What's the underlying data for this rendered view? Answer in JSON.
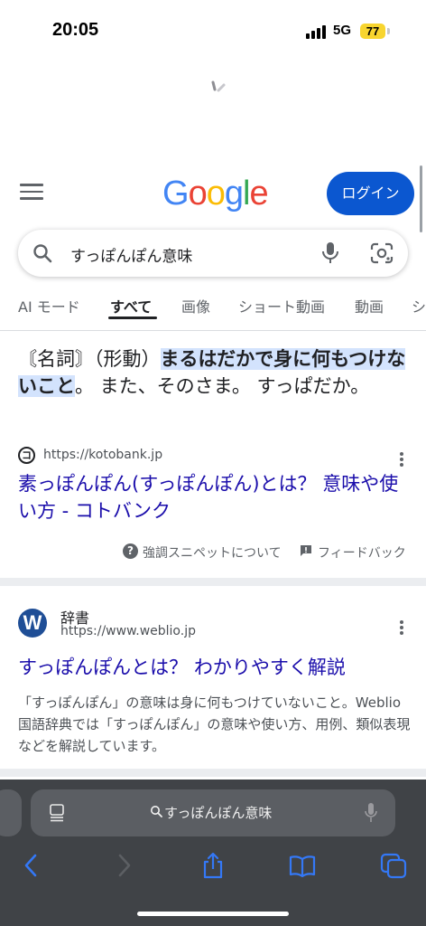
{
  "status_bar": {
    "time": "20:05",
    "network": "5G",
    "battery": "77"
  },
  "header": {
    "logo_letters": [
      {
        "char": "G",
        "color": "#4285F4"
      },
      {
        "char": "o",
        "color": "#EA4335"
      },
      {
        "char": "o",
        "color": "#FBBC05"
      },
      {
        "char": "g",
        "color": "#4285F4"
      },
      {
        "char": "l",
        "color": "#34A853"
      },
      {
        "char": "e",
        "color": "#EA4335"
      }
    ],
    "login_label": "ログイン"
  },
  "search": {
    "query": "すっぽんぽん意味"
  },
  "tabs": [
    "AI モード",
    "すべて",
    "画像",
    "ショート動画",
    "動画",
    "シ"
  ],
  "active_tab": "すべて",
  "featured_snippet": {
    "text_before": "〘名詞〙（形動）",
    "highlight": "まるはだかで身に何もつけないこと",
    "text_after": "。 また、そのさま。 すっぱだか。",
    "site_url": "https://kotobank.jp",
    "favicon_char": "コ",
    "title": "素っぽんぽん(すっぽんぽん)とは？ 意味や使い方 - コトバンク",
    "about_label": "強調スニペットについて",
    "feedback_label": "フィードバック"
  },
  "result2": {
    "favicon_char": "W",
    "site_name": "辞書",
    "url": "https://www.weblio.jp",
    "title": "すっぽんぽんとは？ わかりやすく解説",
    "description": "「すっぽんぽん」の意味は身に何もつけていないこと。Weblio国語辞典では「すっぽんぽん」の意味や使い方、用例、類似表現などを解説しています。"
  },
  "safari": {
    "address_text": "すっぽんぽん意味"
  },
  "colors": {
    "link": "#1a0dab",
    "login_bg": "#0b57d0",
    "highlight_bg": "#d3e3fd",
    "battery": "#f8d52f",
    "toolbar_icon": "#3478f6",
    "toolbar_bg": "#404347"
  }
}
